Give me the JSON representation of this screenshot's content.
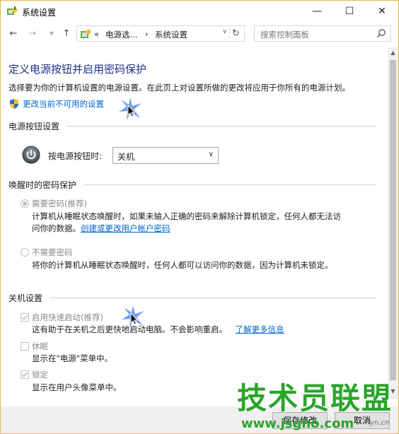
{
  "window": {
    "title": "系统设置"
  },
  "controls": {
    "minimize": "—",
    "maximize": "☐",
    "close": "✕"
  },
  "nav": {
    "back": "←",
    "forward": "→",
    "up": "↑"
  },
  "address": {
    "crumb_overflow": "«",
    "crumb1": "电源选...",
    "sep": "›",
    "crumb2": "系统设置"
  },
  "search": {
    "placeholder": "搜索控制面板"
  },
  "page": {
    "heading": "定义电源按钮并启用密码保护",
    "description": "选择要为你的计算机设置的电源设置。在此页上对设置所做的更改将应用于你所有的电源计划。",
    "admin_link": "更改当前不可用的设置"
  },
  "power_button": {
    "section_title": "电源按钮设置",
    "label": "按电源按钮时:",
    "selected": "关机"
  },
  "wake_password": {
    "section_title": "唤醒时的密码保护",
    "option1_label": "需要密码(推荐)",
    "option1_desc_line1": "计算机从睡眠状态唤醒时，如果未输入正确的密码来解除计算机锁定，任何人都无法访",
    "option1_desc_line2_prefix": "问你的数据。",
    "option1_link": "创建或更改用户帐户密码",
    "option2_label": "不需要密码",
    "option2_desc": "将你的计算机从睡眠状态唤醒时，任何人都可以访问你的数据，因为计算机未锁定。"
  },
  "shutdown": {
    "section_title": "关机设置",
    "fast_startup_label": "启用快速启动(推荐)",
    "fast_startup_desc": "这有助于在关机之后更快地启动电脑。不会影响重启。",
    "fast_startup_link": "了解更多信息",
    "hibernate_label": "休眠",
    "hibernate_desc": "显示在\"电源\"菜单中。",
    "lock_label": "锁定",
    "lock_desc": "显示在用户头像菜单中。",
    "fast_startup_checked": true,
    "hibernate_checked": false,
    "lock_checked": true
  },
  "footer": {
    "save_label": "保存修改",
    "cancel_label": "取消"
  },
  "watermark": {
    "text_cn": "技术员联盟",
    "text_url": "www.jsgho.com",
    "text_small": "yn.cn"
  },
  "colors": {
    "heading": "#1e3287",
    "link": "#0066cc",
    "watermark": "#2aa52a"
  }
}
